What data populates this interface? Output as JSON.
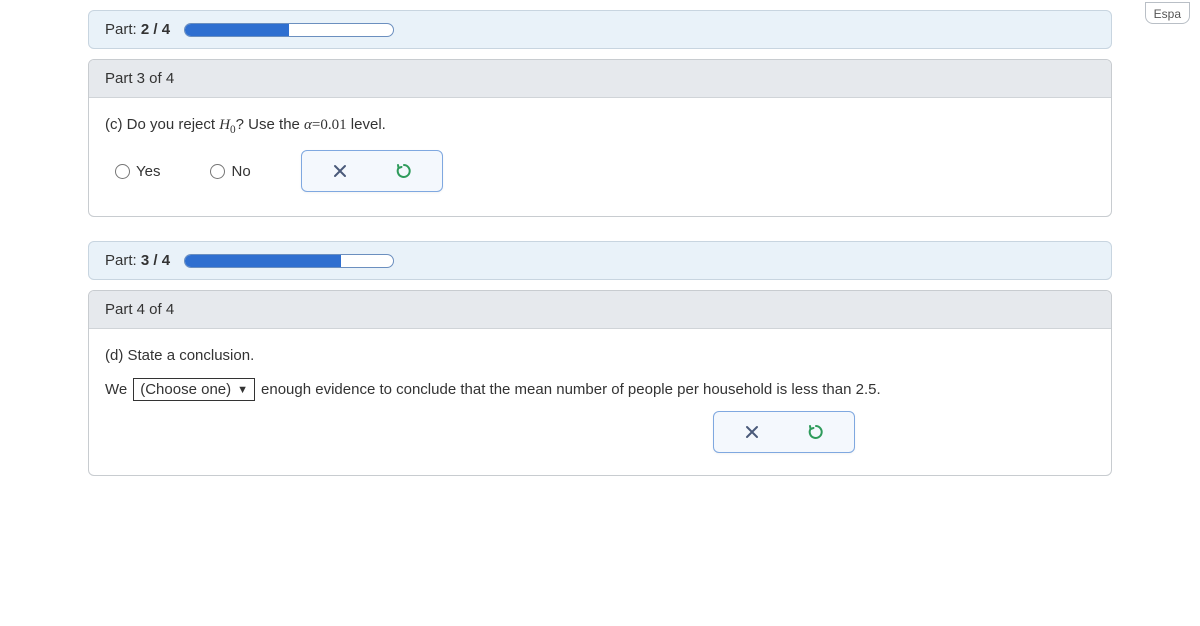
{
  "topPill": "Espa",
  "partProgress2": {
    "labelPrefix": "Part: ",
    "labelValue": "2 / 4",
    "percent": 50
  },
  "part3": {
    "header": "Part 3 of 4",
    "questionPrefix": "(c) Do you reject ",
    "hypothesis": "H",
    "hypSub": "0",
    "questionMid": "? Use the ",
    "alpha": "α",
    "equals": "=",
    "alphaVal": "0.01",
    "levelText": " level.",
    "optYes": "Yes",
    "optNo": "No"
  },
  "partProgress3": {
    "labelPrefix": "Part: ",
    "labelValue": "3 / 4",
    "percent": 75
  },
  "part4": {
    "header": "Part 4 of 4",
    "questionLabel": "(d) State a conclusion.",
    "wePrefix": "We",
    "chooseOne": "(Choose one)",
    "tail1": "enough evidence to conclude that the mean number of people per household is less than ",
    "tailNum": "2.5",
    "period": "."
  },
  "icons": {
    "close": "close-icon",
    "reset": "reset-icon",
    "dropdown": "chevron-down-icon"
  }
}
